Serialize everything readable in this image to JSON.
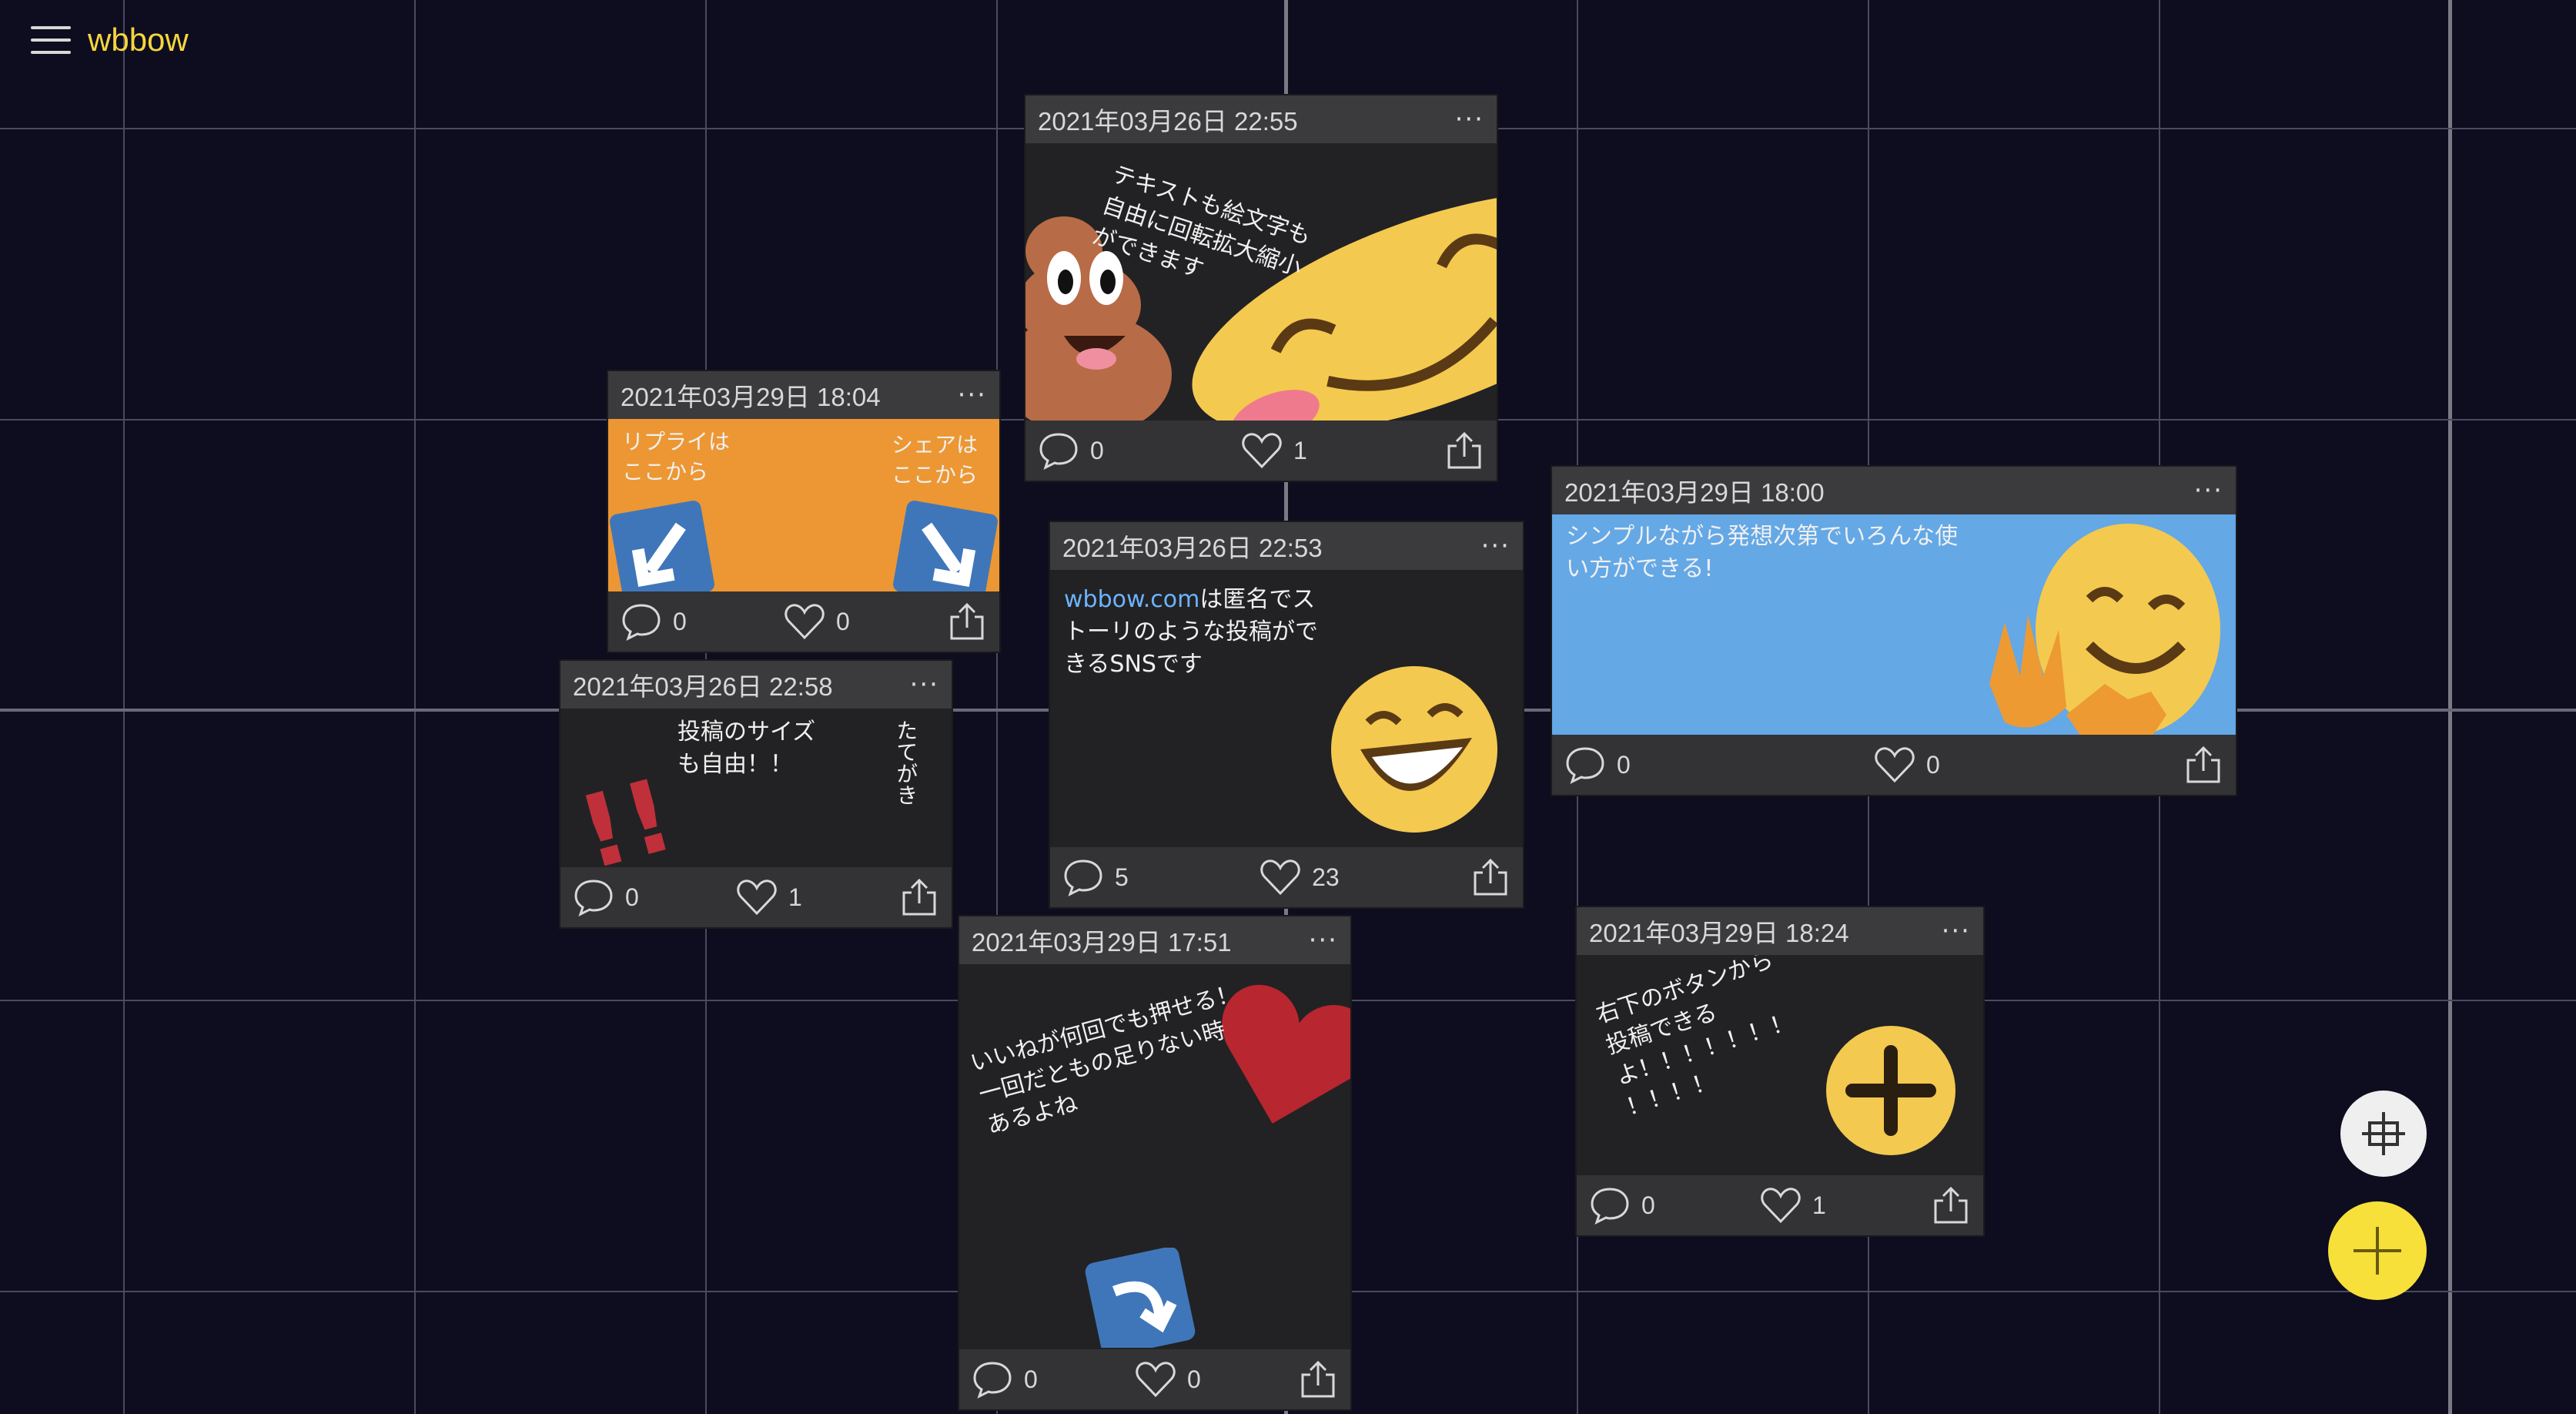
{
  "app": {
    "logo": "wbbow"
  },
  "labels": {
    "speech1": "!!"
  },
  "posts": [
    {
      "date": "2021年03月26日 22:55",
      "menu": "···",
      "text": "テキストも絵文字も\n自由に回転拡大縮小\nができます",
      "comments": "0",
      "likes": "1"
    },
    {
      "date": "2021年03月29日 18:04",
      "menu": "···",
      "text_left": "リプライは\nここから",
      "text_right": "シェアは\nここから",
      "comments": "0",
      "likes": "0"
    },
    {
      "date": "2021年03月26日 22:53",
      "menu": "···",
      "link": "wbbow.com",
      "text": "は匿名でス\nトーリのような投稿がで\nきるSNSです",
      "comments": "5",
      "likes": "23"
    },
    {
      "date": "2021年03月29日 18:00",
      "menu": "···",
      "text": "シンプルながら発想次第でいろんな使\nい方ができる!",
      "comments": "0",
      "likes": "0"
    },
    {
      "date": "2021年03月26日 22:58",
      "menu": "···",
      "text": "投稿のサイズ\nも自由！！",
      "text_vertical": "たてがき",
      "comments": "0",
      "likes": "1"
    },
    {
      "date": "2021年03月29日 17:51",
      "menu": "···",
      "text": "いいねが何回でも押せる！\n一回だともの足りない時\nあるよね",
      "comments": "0",
      "likes": "0"
    },
    {
      "date": "2021年03月29日 18:24",
      "menu": "···",
      "text": "右下のボタンから\n投稿できる\nよ！！！！！！！\n！！！！",
      "comments": "0",
      "likes": "1"
    }
  ],
  "colors": {
    "logo": "#f5d63d",
    "fab_add": "#f7e03a",
    "fab_center": "#efefef",
    "link": "#6cb4ff"
  },
  "icons": {
    "menu": "hamburger-icon",
    "comment": "speech-bubble-icon",
    "like": "heart-outline-icon",
    "share": "share-icon",
    "center": "crosshair-icon",
    "add": "plus-icon"
  }
}
